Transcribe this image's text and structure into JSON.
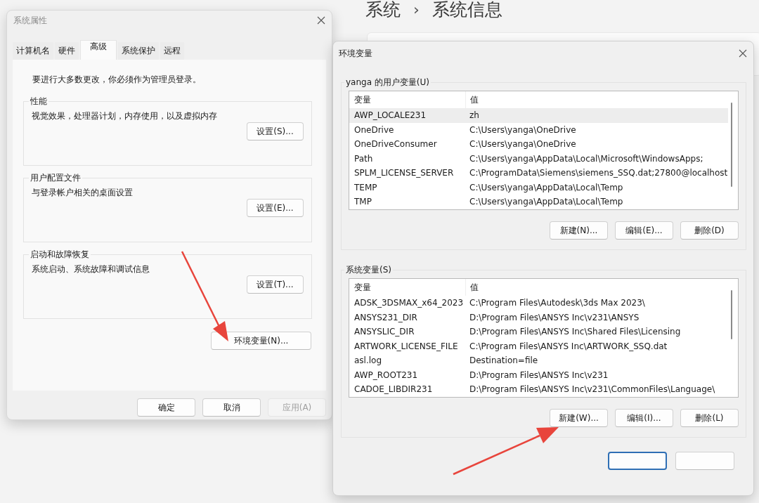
{
  "background": {
    "breadcrumb": [
      {
        "kind": "parent",
        "text": "系统"
      },
      {
        "kind": "separator",
        "text": "›"
      },
      {
        "kind": "current",
        "text": "系统信息"
      }
    ]
  },
  "system_properties": {
    "title": "系统属性",
    "tabs": [
      {
        "label": "计算机名",
        "selected": false
      },
      {
        "label": "硬件",
        "selected": false
      },
      {
        "label": "高级",
        "selected": true
      },
      {
        "label": "系统保护",
        "selected": false
      },
      {
        "label": "远程",
        "selected": false
      }
    ],
    "notice": "要进行大多数更改，你必须作为管理员登录。",
    "groups": [
      {
        "title": "性能",
        "description": "视觉效果，处理器计划，内存使用，以及虚拟内存",
        "button": "设置(S)..."
      },
      {
        "title": "用户配置文件",
        "description": "与登录帐户相关的桌面设置",
        "button": "设置(E)..."
      },
      {
        "title": "启动和故障恢复",
        "description": "系统启动、系统故障和调试信息",
        "button": "设置(T)..."
      }
    ],
    "env_button": "环境变量(N)...",
    "buttons": [
      {
        "label": "确定",
        "disabled": false
      },
      {
        "label": "取消",
        "disabled": false
      },
      {
        "label": "应用(A)",
        "disabled": true
      }
    ]
  },
  "environment_variables": {
    "title": "环境变量",
    "sections": [
      {
        "title": "yanga 的用户变量(U)",
        "columns": [
          "变量",
          "值"
        ],
        "rows": [
          {
            "name": "AWP_LOCALE231",
            "value": "zh",
            "selected": true
          },
          {
            "name": "OneDrive",
            "value": "C:\\Users\\yanga\\OneDrive",
            "selected": false
          },
          {
            "name": "OneDriveConsumer",
            "value": "C:\\Users\\yanga\\OneDrive",
            "selected": false
          },
          {
            "name": "Path",
            "value": "C:\\Users\\yanga\\AppData\\Local\\Microsoft\\WindowsApps;",
            "selected": false
          },
          {
            "name": "SPLM_LICENSE_SERVER",
            "value": "C:\\ProgramData\\Siemens\\siemens_SSQ.dat;27800@localhost",
            "selected": false
          },
          {
            "name": "TEMP",
            "value": "C:\\Users\\yanga\\AppData\\Local\\Temp",
            "selected": false
          },
          {
            "name": "TMP",
            "value": "C:\\Users\\yanga\\AppData\\Local\\Temp",
            "selected": false
          }
        ],
        "buttons": [
          "新建(N)...",
          "编辑(E)...",
          "删除(D)"
        ]
      },
      {
        "title": "系统变量(S)",
        "columns": [
          "变量",
          "值"
        ],
        "rows": [
          {
            "name": "ADSK_3DSMAX_x64_2023",
            "value": "C:\\Program Files\\Autodesk\\3ds Max 2023\\",
            "selected": false
          },
          {
            "name": "ANSYS231_DIR",
            "value": "D:\\Program Files\\ANSYS Inc\\v231\\ANSYS",
            "selected": false
          },
          {
            "name": "ANSYSLIC_DIR",
            "value": "D:\\Program Files\\ANSYS Inc\\Shared Files\\Licensing",
            "selected": false
          },
          {
            "name": "ARTWORK_LICENSE_FILE",
            "value": "C:\\Program Files\\ANSYS Inc\\ARTWORK_SSQ.dat",
            "selected": false
          },
          {
            "name": "asl.log",
            "value": "Destination=file",
            "selected": false
          },
          {
            "name": "AWP_ROOT231",
            "value": "D:\\Program Files\\ANSYS Inc\\v231",
            "selected": false
          },
          {
            "name": "CADOE_LIBDIR231",
            "value": "D:\\Program Files\\ANSYS Inc\\v231\\CommonFiles\\Language\\",
            "selected": false
          }
        ],
        "buttons": [
          "新建(W)...",
          "编辑(I)...",
          "删除(L)"
        ]
      }
    ],
    "footer_buttons": [
      {
        "default": true
      },
      {
        "default": false
      }
    ]
  }
}
